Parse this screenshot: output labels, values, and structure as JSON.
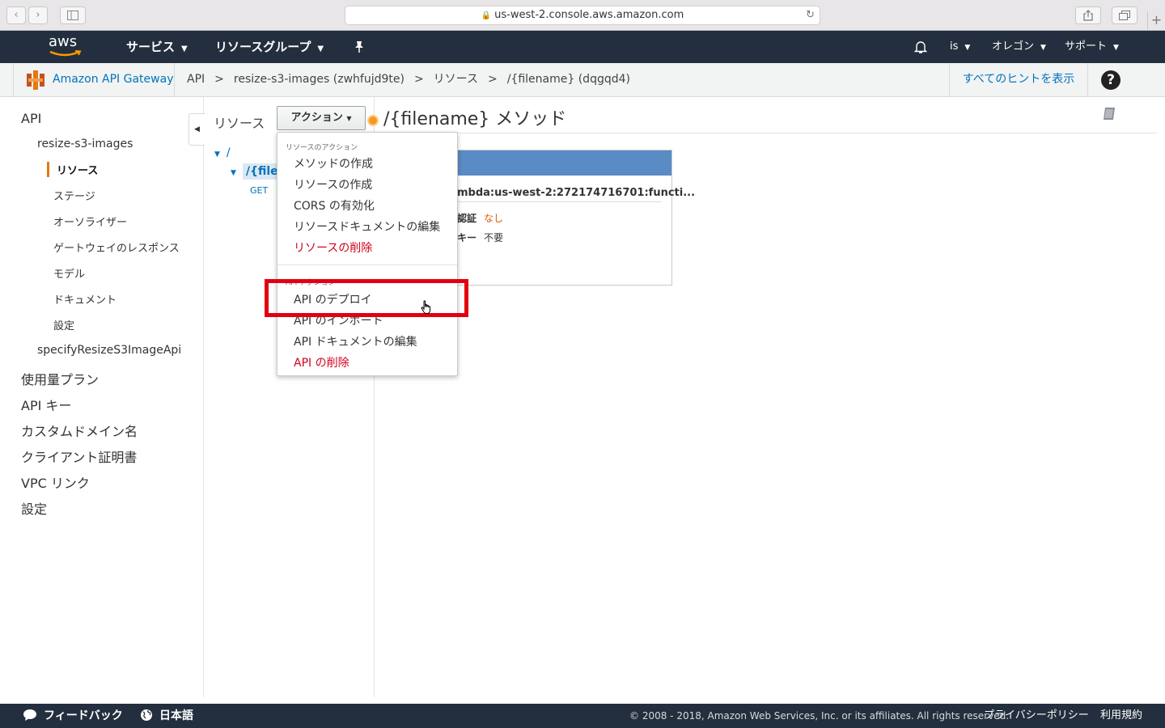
{
  "browser": {
    "url": "us-west-2.console.aws.amazon.com"
  },
  "aws_nav": {
    "logo_text": "aws",
    "services": "サービス",
    "resource_groups": "リソースグループ",
    "user": "is",
    "region": "オレゴン",
    "support": "サポート"
  },
  "breadcrumb": {
    "service": "Amazon API Gateway",
    "items": [
      "API",
      "resize-s3-images (zwhfujd9te)",
      "リソース",
      "/{filename} (dqgqd4)"
    ],
    "separator": ">",
    "hints": "すべてのヒントを表示",
    "help": "?"
  },
  "sidebar": {
    "api": "API",
    "api_name": "resize-s3-images",
    "sub_items": [
      "リソース",
      "ステージ",
      "オーソライザー",
      "ゲートウェイのレスポンス",
      "モデル",
      "ドキュメント",
      "設定"
    ],
    "other_api": "specifyResizeS3ImageApi",
    "top_items": [
      "使用量プラン",
      "API キー",
      "カスタムドメイン名",
      "クライアント証明書",
      "VPC リンク",
      "設定"
    ]
  },
  "resources": {
    "title": "リソース",
    "actions_button": "アクション",
    "tree_root": "/",
    "tree_child": "/{filen",
    "method": "GET"
  },
  "main": {
    "title": "/{filename} メソッド",
    "lambda_text": "mbda:us-west-2:272174716701:functi...",
    "auth_label": "認証",
    "auth_value": "なし",
    "key_label": "キー",
    "key_value": "不要"
  },
  "dropdown": {
    "resource_section": "リソースのアクション",
    "resource_actions": [
      "メソッドの作成",
      "リソースの作成",
      "CORS の有効化",
      "リソースドキュメントの編集"
    ],
    "delete_resource": "リソースの削除",
    "api_section": "API アクション",
    "api_actions": [
      "API のデプロイ",
      "API のインポート",
      "API ドキュメントの編集"
    ],
    "delete_api": "API の削除"
  },
  "footer": {
    "feedback": "フィードバック",
    "language": "日本語",
    "copyright": "© 2008 - 2018, Amazon Web Services, Inc. or its affiliates. All rights reserved.",
    "privacy": "プライバシーポリシー",
    "terms": "利用規約"
  },
  "colors": {
    "nav_bg": "#232f3e",
    "link": "#0073bb",
    "danger": "#d0021b",
    "accent": "#e47911",
    "highlight": "#e3000f",
    "card_header": "#5a8bc4"
  }
}
